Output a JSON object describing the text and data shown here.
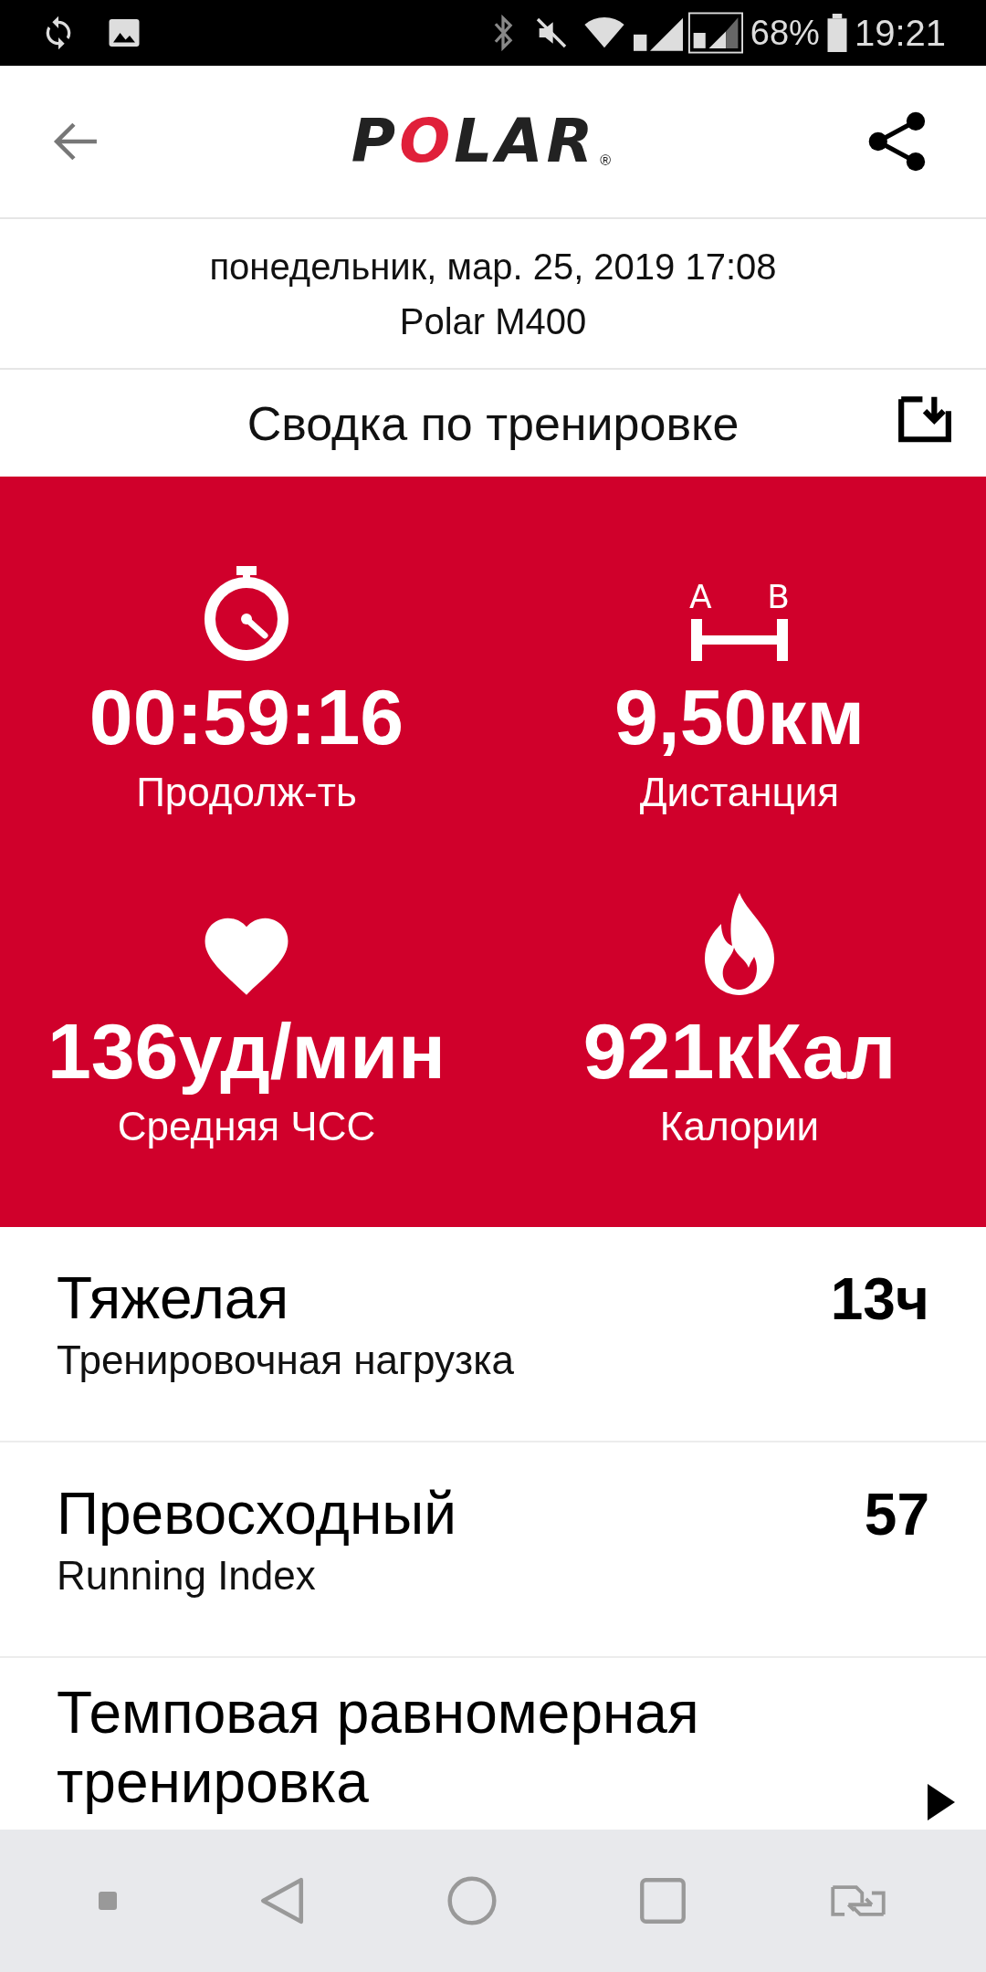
{
  "status_bar": {
    "battery": "68%",
    "time": "19:21"
  },
  "header": {
    "logo": "POLAR",
    "logo_mark": "®"
  },
  "session": {
    "date": "понедельник, мар. 25, 2019 17:08",
    "device": "Polar M400"
  },
  "section": {
    "title": "Сводка по тренировке"
  },
  "distance_icon": {
    "endpoints": [
      "A",
      "B"
    ]
  },
  "metrics": [
    {
      "kind": "duration",
      "value": "00:59:16",
      "label": "Продолж-ть"
    },
    {
      "kind": "distance",
      "value": "9,50км",
      "label": "Дистанция"
    },
    {
      "kind": "heart",
      "value": "136уд/мин",
      "label": "Средняя ЧСС"
    },
    {
      "kind": "calories",
      "value": "921кКал",
      "label": "Калории"
    }
  ],
  "rows": [
    {
      "title": "Тяжелая",
      "subtitle": "Тренировочная нагрузка",
      "value": "13ч",
      "arrow": false
    },
    {
      "title": "Превосходный",
      "subtitle": "Running Index",
      "value": "57",
      "arrow": false
    },
    {
      "title": "Темповая равномерная тренировка",
      "arrow": true
    }
  ]
}
